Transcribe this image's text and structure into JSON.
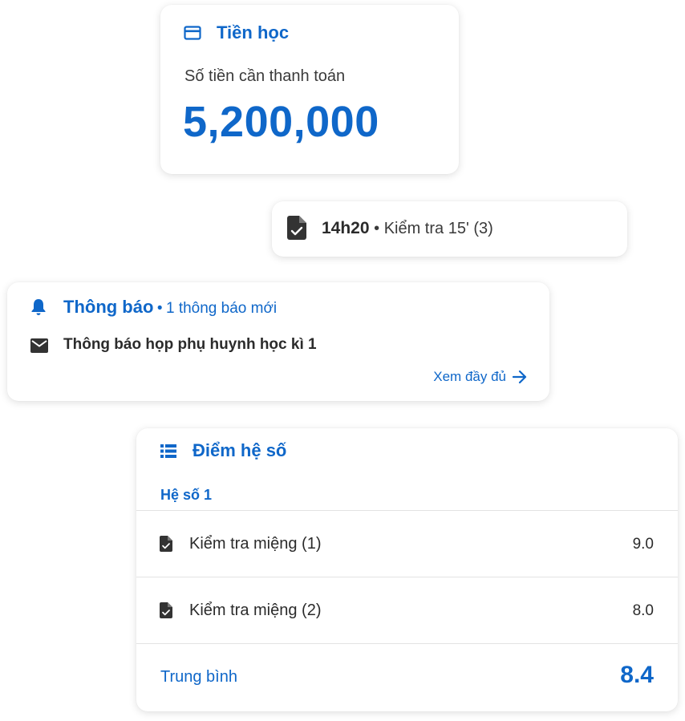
{
  "tuition": {
    "title": "Tiền học",
    "subtitle": "Số tiền cần thanh toán",
    "amount": "5,200,000",
    "icon": "credit-card-icon"
  },
  "schedule": {
    "time": "14h20",
    "separator": "•",
    "event": "Kiểm tra 15' (3)",
    "icon": "assignment-check-icon"
  },
  "notice": {
    "title": "Thông báo",
    "separator": "•",
    "count_text": "1 thông báo mới",
    "message": "Thông báo họp phụ huynh học kì 1",
    "view_all": "Xem đầy đủ",
    "icons": [
      "bell-icon",
      "mail-icon",
      "arrow-right-icon"
    ]
  },
  "grades": {
    "title": "Điểm hệ số",
    "group": "Hệ số 1",
    "rows": [
      {
        "name": "Kiểm tra miệng (1)",
        "score": "9.0"
      },
      {
        "name": "Kiểm tra miệng (2)",
        "score": "8.0"
      }
    ],
    "average_label": "Trung bình",
    "average_value": "8.4",
    "icon": "list-icon"
  },
  "colors": {
    "accent": "#0f67c9",
    "text": "#2b2b2b",
    "divider": "#e3e3e3"
  }
}
